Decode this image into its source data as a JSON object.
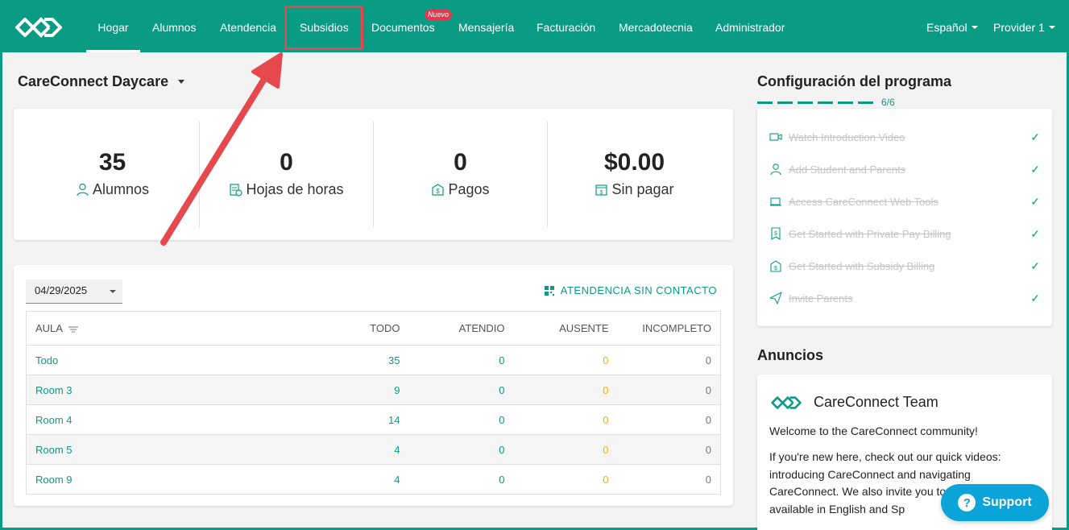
{
  "navbar": {
    "items": [
      {
        "label": "Hogar",
        "active": true
      },
      {
        "label": "Alumnos"
      },
      {
        "label": "Atendencia"
      },
      {
        "label": "Subsidios"
      },
      {
        "label": "Documentos",
        "badge": "Nuevo"
      },
      {
        "label": "Mensajería"
      },
      {
        "label": "Facturación"
      },
      {
        "label": "Mercadotecnia"
      },
      {
        "label": "Administrador"
      }
    ],
    "language": "Español",
    "user": "Provider 1"
  },
  "center": {
    "name": "CareConnect Daycare"
  },
  "stats": [
    {
      "value": "35",
      "label": "Alumnos",
      "icon": "person-icon"
    },
    {
      "value": "0",
      "label": "Hojas de horas",
      "icon": "timesheet-icon"
    },
    {
      "value": "0",
      "label": "Pagos",
      "icon": "payment-icon"
    },
    {
      "value": "$0.00",
      "label": "Sin pagar",
      "icon": "unpaid-icon"
    }
  ],
  "attendance": {
    "date": "04/29/2025",
    "contactless_label": "ATENDENCIA SIN CONTACTO",
    "columns": [
      "AULA",
      "TODO",
      "ATENDIO",
      "AUSENTE",
      "INCOMPLETO"
    ],
    "rows": [
      {
        "room": "Todo",
        "total": "35",
        "attended": "0",
        "absent": "0",
        "incomplete": "0"
      },
      {
        "room": "Room 3",
        "total": "9",
        "attended": "0",
        "absent": "0",
        "incomplete": "0"
      },
      {
        "room": "Room 4",
        "total": "14",
        "attended": "0",
        "absent": "0",
        "incomplete": "0"
      },
      {
        "room": "Room 5",
        "total": "4",
        "attended": "0",
        "absent": "0",
        "incomplete": "0"
      },
      {
        "room": "Room 9",
        "total": "4",
        "attended": "0",
        "absent": "0",
        "incomplete": "0"
      }
    ]
  },
  "setup": {
    "title": "Configuración del programa",
    "progress": "6/6",
    "completed_fraction": 1.0,
    "tasks": [
      {
        "label": "Watch Introduction Video",
        "icon": "video-icon"
      },
      {
        "label": "Add Student and Parents",
        "icon": "person-icon"
      },
      {
        "label": "Access CareConnect Web Tools",
        "icon": "laptop-icon"
      },
      {
        "label": "Get Started with Private Pay Billing",
        "icon": "receipt-icon"
      },
      {
        "label": "Get Started with Subsidy Billing",
        "icon": "subsidy-icon"
      },
      {
        "label": "Invite Parents",
        "icon": "send-icon"
      }
    ]
  },
  "announcements": {
    "title": "Anuncios",
    "author": "CareConnect Team",
    "p1": "Welcome to the CareConnect community!",
    "p2": "If you're new here, check out our quick videos: introducing CareConnect and navigating CareConnect. We also invite you to join our webinar, available in English and Sp"
  },
  "support": {
    "label": "Support"
  },
  "colors": {
    "brand": "#0a9b85",
    "absent": "#f0b400",
    "highlight": "#e5484d",
    "support": "#0aa4d8"
  }
}
